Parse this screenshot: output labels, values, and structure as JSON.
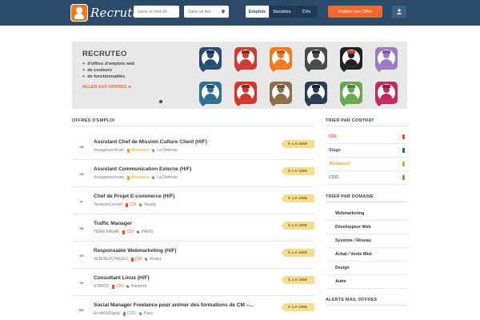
{
  "header": {
    "logo_text": "RecruteO",
    "search_keyword_placeholder": "Saisir un mot clé",
    "search_location_placeholder": "Saisir un lieu",
    "nav": [
      "Emplois",
      "Sociétés",
      "CVs"
    ],
    "publish_label": "Publier une Offre",
    "user_icon": "user-icon"
  },
  "hero": {
    "title": "RECRUTEO",
    "bullets": [
      "d'offres d'emplois web",
      "de couleurs",
      "de fonctionnalités"
    ],
    "link_label": "ALLER AUX OFFRES",
    "avatars": [
      {
        "bg": "#274d73",
        "body": "#274d73",
        "head": "#274d73",
        "hat": "#1a3656"
      },
      {
        "bg": "#d23a36",
        "body": "#d23a36",
        "head": "#d23a36",
        "hat": "#9e2622"
      },
      {
        "bg": "#f07a1e",
        "body": "#f07a1e",
        "head": "#f07a1e",
        "hat": "#c45d10"
      },
      {
        "bg": "#4a4a4a",
        "body": "#4a4a4a",
        "head": "#4a4a4a",
        "hat": "#2a2a2a"
      },
      {
        "bg": "#222222",
        "body": "#222222",
        "head": "#222222",
        "hat": "#d23a36"
      },
      {
        "bg": "#9b7bc4",
        "body": "#9b7bc4",
        "head": "#9b7bc4",
        "hat": "#7b5aa6"
      },
      {
        "bg": "#2f6f8f",
        "body": "#2f6f8f",
        "head": "#2f6f8f",
        "hat": "#1f4f68"
      },
      {
        "bg": "#d7342e",
        "body": "#d7342e",
        "head": "#d7342e",
        "hat": "#a3221e"
      },
      {
        "bg": "#8a6f4a",
        "body": "#8a6f4a",
        "head": "#8a6f4a",
        "hat": "#6b5536"
      },
      {
        "bg": "#2b3b52",
        "body": "#2b3b52",
        "head": "#2b3b52",
        "hat": "#182435"
      },
      {
        "bg": "#6aa84f",
        "body": "#6aa84f",
        "head": "#6aa84f",
        "hat": "#4d8236"
      },
      {
        "bg": "#c22c5c",
        "body": "#c22c5c",
        "head": "#c22c5c",
        "hat": "#921e44"
      }
    ]
  },
  "jobs_section": {
    "title": "OFFRES D'EMPLOI"
  },
  "jobs": [
    {
      "logo": "VS",
      "title": "Assistant Chef de Mission Culture Client (H/F)",
      "company": "Voyagessncfcom",
      "contract": "Alernance",
      "contract_color": "#f0a020",
      "place": "La Defense",
      "badge": "À LA UNE"
    },
    {
      "logo": "VS",
      "title": "Assistant Communication Externe (H/F)",
      "company": "Voyagessncfcom",
      "contract": "Alernance",
      "contract_color": "#f0a020",
      "place": "La Defense",
      "badge": "À LA UNE"
    },
    {
      "logo": "tc",
      "title": "Chef de Projet E-commerce (H/F)",
      "company": "TemenioConseil",
      "contract": "CDI",
      "contract_color": "#e8532b",
      "place": "Neuilly",
      "badge": "À LA UNE"
    },
    {
      "logo": "TB",
      "title": "Traffic Manager",
      "company": "TEAM BREAK",
      "contract": "CDI",
      "contract_color": "#e8532b",
      "place": "PARIS",
      "badge": "À LA UNE"
    },
    {
      "logo": "VV",
      "title": "Responsable Webmarketing (H/F)",
      "company": "VERDIEVOYAGES",
      "contract": "CDI",
      "contract_color": "#e8532b",
      "place": "Rodez",
      "badge": "À LA UNE"
    },
    {
      "logo": "TA",
      "title": "Consultant Linux (H/F)",
      "company": "STARTX",
      "contract": "CDI",
      "contract_color": "#e8532b",
      "place": "Nanterre",
      "badge": "À LA UNE"
    },
    {
      "logo": "ED",
      "title": "Social Manager Freelance pour animer des formations de CM –...",
      "company": "EcoleDuDigital",
      "contract": "CDD",
      "contract_color": "#6aa84f",
      "place": "Paris",
      "badge": "À LA UNE"
    }
  ],
  "sidebar": {
    "contract_title": "TRIER PAR CONTRAT",
    "contracts": [
      {
        "label": "CDI",
        "color": "#e8532b"
      },
      {
        "label": "Stage",
        "color": "#2b5fb3"
      },
      {
        "label": "Alernance",
        "color": "#f0a020"
      },
      {
        "label": "CDD",
        "color": "#6aa84f"
      }
    ],
    "domain_title": "TRIER PAR DOMAINE",
    "domains": [
      "Webmarketing",
      "Développeur Web",
      "Système / Réseau",
      "Achat / Vente Web",
      "Design",
      "Autre"
    ],
    "alert_title": "ALERTE MAIL OFFRES"
  },
  "colors": {
    "header_bg": "#2b4b6b",
    "accent": "#f26a2e",
    "badge_bg": "#f6dc8f"
  }
}
